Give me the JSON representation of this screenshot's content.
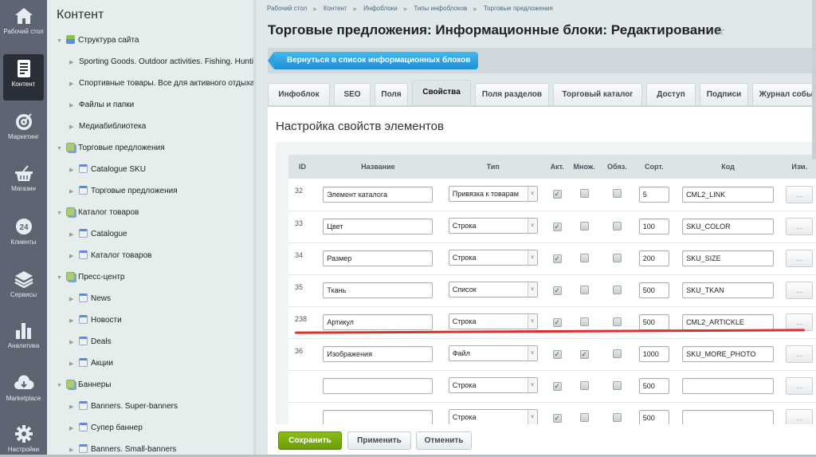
{
  "leftbar": {
    "items": [
      {
        "label": "Рабочий стол",
        "icon": "home-icon"
      },
      {
        "label": "Контент",
        "icon": "document-icon",
        "active": true
      },
      {
        "label": "Маркетинг",
        "icon": "target-icon"
      },
      {
        "label": "Магазин",
        "icon": "basket-icon"
      },
      {
        "label": "Клиенты",
        "icon": "clients-24-icon"
      },
      {
        "label": "Сервисы",
        "icon": "layers-icon"
      },
      {
        "label": "Аналитика",
        "icon": "bar-chart-icon"
      },
      {
        "label": "Marketplace",
        "icon": "cloud-download-icon"
      },
      {
        "label": "Настройки",
        "icon": "gear-icon"
      }
    ]
  },
  "tree": {
    "title": "Контент",
    "nodes": [
      {
        "label": "Структура сайта",
        "level": 0,
        "icon": "structure",
        "expanded": true
      },
      {
        "label": "Sporting Goods. Outdoor activities. Fishing. Hunti",
        "level": 1
      },
      {
        "label": "Спортивные товары. Все для активного отдыха.",
        "level": 1
      },
      {
        "label": "Файлы и папки",
        "level": 1
      },
      {
        "label": "Медиабиблиотека",
        "level": 1
      },
      {
        "label": "Торговые предложения",
        "level": 0,
        "icon": "folder",
        "expanded": true
      },
      {
        "label": "Catalogue SKU",
        "level": 1,
        "icon": "iblock"
      },
      {
        "label": "Торговые предложения",
        "level": 1,
        "icon": "iblock"
      },
      {
        "label": "Каталог товаров",
        "level": 0,
        "icon": "folder",
        "expanded": true
      },
      {
        "label": "Catalogue",
        "level": 1,
        "icon": "iblock"
      },
      {
        "label": "Каталог товаров",
        "level": 1,
        "icon": "iblock"
      },
      {
        "label": "Пресс-центр",
        "level": 0,
        "icon": "folder",
        "expanded": true
      },
      {
        "label": "News",
        "level": 1,
        "icon": "iblock"
      },
      {
        "label": "Новости",
        "level": 1,
        "icon": "iblock"
      },
      {
        "label": "Deals",
        "level": 1,
        "icon": "iblock"
      },
      {
        "label": "Акции",
        "level": 1,
        "icon": "iblock"
      },
      {
        "label": "Баннеры",
        "level": 0,
        "icon": "folder",
        "expanded": true
      },
      {
        "label": "Banners. Super-banners",
        "level": 1,
        "icon": "iblock"
      },
      {
        "label": "Супер баннер",
        "level": 1,
        "icon": "iblock"
      },
      {
        "label": "Banners. Small-banners",
        "level": 1,
        "icon": "iblock"
      }
    ]
  },
  "breadcrumb": [
    "Рабочий стол",
    "Контент",
    "Инфоблоки",
    "Типы инфоблоков",
    "Торговые предложения"
  ],
  "page": {
    "title": "Торговые предложения: Информационные блоки: Редактирование",
    "back_button": "Вернуться в список информационных блоков"
  },
  "tabs": [
    {
      "label": "Инфоблок"
    },
    {
      "label": "SEO"
    },
    {
      "label": "Поля"
    },
    {
      "label": "Свойства",
      "active": true
    },
    {
      "label": "Поля разделов"
    },
    {
      "label": "Торговый каталог"
    },
    {
      "label": "Доступ"
    },
    {
      "label": "Подписи"
    },
    {
      "label": "Журнал событ"
    }
  ],
  "section_title": "Настройка свойств элементов",
  "table": {
    "headers": [
      "ID",
      "Название",
      "Тип",
      "Акт.",
      "Множ.",
      "Обяз.",
      "Сорт.",
      "Код",
      "Изм."
    ],
    "rows": [
      {
        "id": "32",
        "name": "Элемент каталога",
        "type": "Привязка к товарам",
        "active": true,
        "multiple": false,
        "required": false,
        "sort": "5",
        "code": "CML2_LINK"
      },
      {
        "id": "33",
        "name": "Цвет",
        "type": "Строка",
        "active": true,
        "multiple": false,
        "required": false,
        "sort": "100",
        "code": "SKU_COLOR"
      },
      {
        "id": "34",
        "name": "Размер",
        "type": "Строка",
        "active": true,
        "multiple": false,
        "required": false,
        "sort": "200",
        "code": "SKU_SIZE"
      },
      {
        "id": "35",
        "name": "Ткань",
        "type": "Список",
        "active": true,
        "multiple": false,
        "required": false,
        "sort": "500",
        "code": "SKU_TKAN"
      },
      {
        "id": "238",
        "name": "Артикул",
        "type": "Строка",
        "active": true,
        "multiple": false,
        "required": false,
        "sort": "500",
        "code": "CML2_ARTICKLE",
        "highlighted": true
      },
      {
        "id": "36",
        "name": "Изображения",
        "type": "Файл",
        "active": true,
        "multiple": true,
        "required": false,
        "sort": "1000",
        "code": "SKU_MORE_PHOTO"
      },
      {
        "id": "",
        "name": "",
        "type": "Строка",
        "active": true,
        "multiple": false,
        "required": false,
        "sort": "500",
        "code": ""
      },
      {
        "id": "",
        "name": "",
        "type": "Строка",
        "active": true,
        "multiple": false,
        "required": false,
        "sort": "500",
        "code": ""
      }
    ],
    "more_label": "..."
  },
  "footer": {
    "save": "Сохранить",
    "apply": "Применить",
    "cancel": "Отменить"
  },
  "colors": {
    "accent_blue": "#1a8fd4",
    "save_green": "#7aab0e",
    "highlight_red": "#d9312d",
    "leftbar_bg": "#5d6573"
  }
}
